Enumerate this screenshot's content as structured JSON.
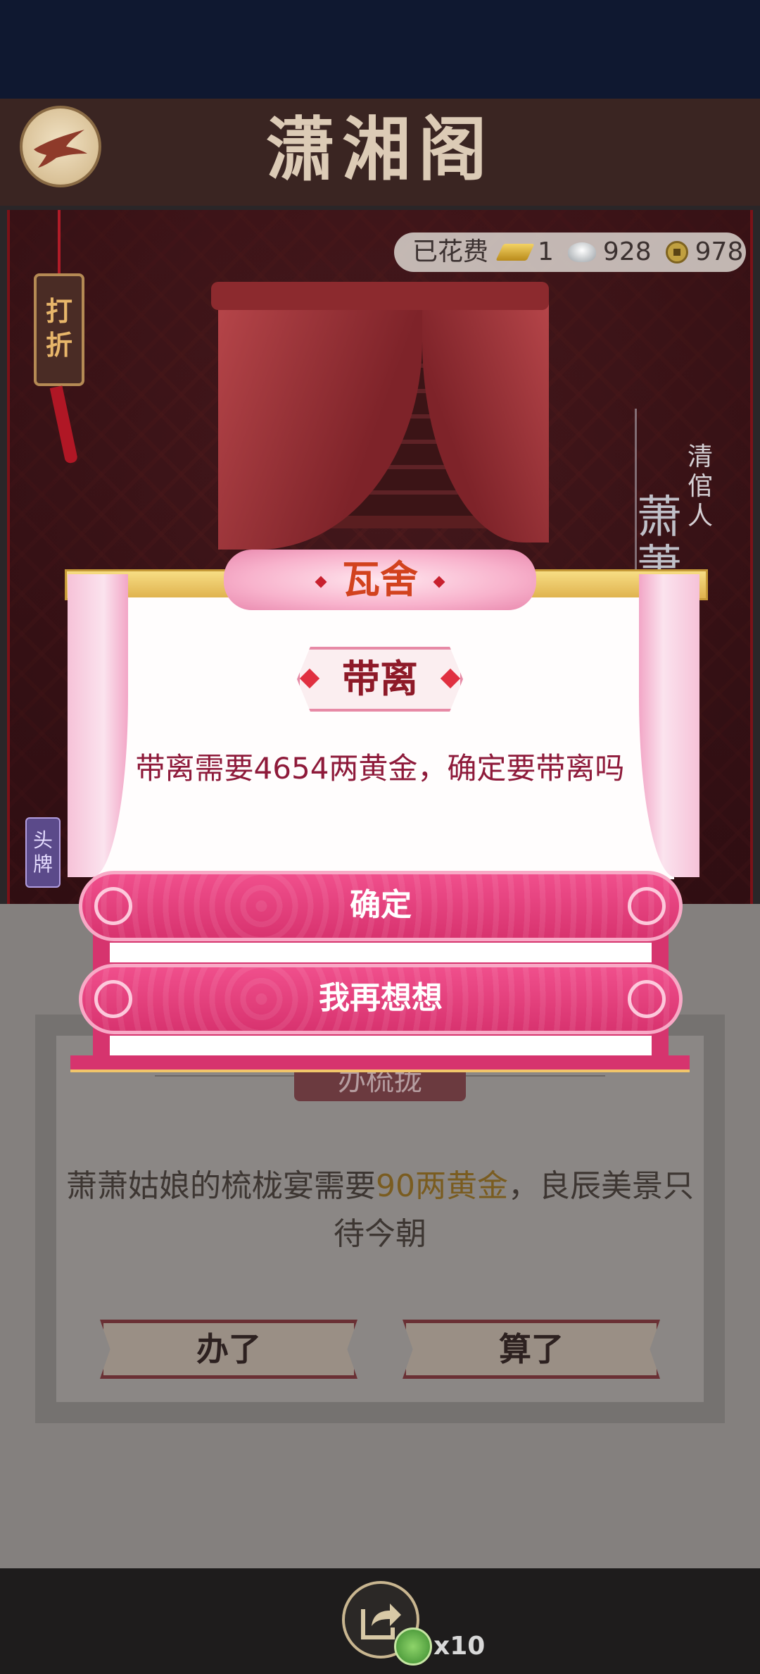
{
  "header": {
    "title": "潇湘阁",
    "back_icon": "bird-back-icon"
  },
  "scene": {
    "discount_tag": "打折",
    "spent": {
      "label": "已花费",
      "gold": "1",
      "silver": "928",
      "copper": "978"
    },
    "character": {
      "role": "清倌人",
      "name": "萧萧"
    },
    "headplate_tag": "头牌"
  },
  "lower_panel": {
    "subtitle": "办梳拢",
    "message_prefix": "萧萧姑娘的梳栊宴需要",
    "message_highlight": "90两黄金",
    "message_suffix": "，良辰美景只待今朝",
    "button_do": "办了",
    "button_skip": "算了"
  },
  "modal": {
    "title": "瓦舍",
    "heading": "带离",
    "message": "带离需要4654两黄金，确定要带离吗",
    "confirm": "确定",
    "reconsider": "我再想想"
  },
  "bottom": {
    "share_icon": "share-icon",
    "reward_count": "x10"
  },
  "colors": {
    "modal_button": "#e0407c",
    "modal_title": "#d2421e",
    "modal_text": "#8e1a3a"
  }
}
